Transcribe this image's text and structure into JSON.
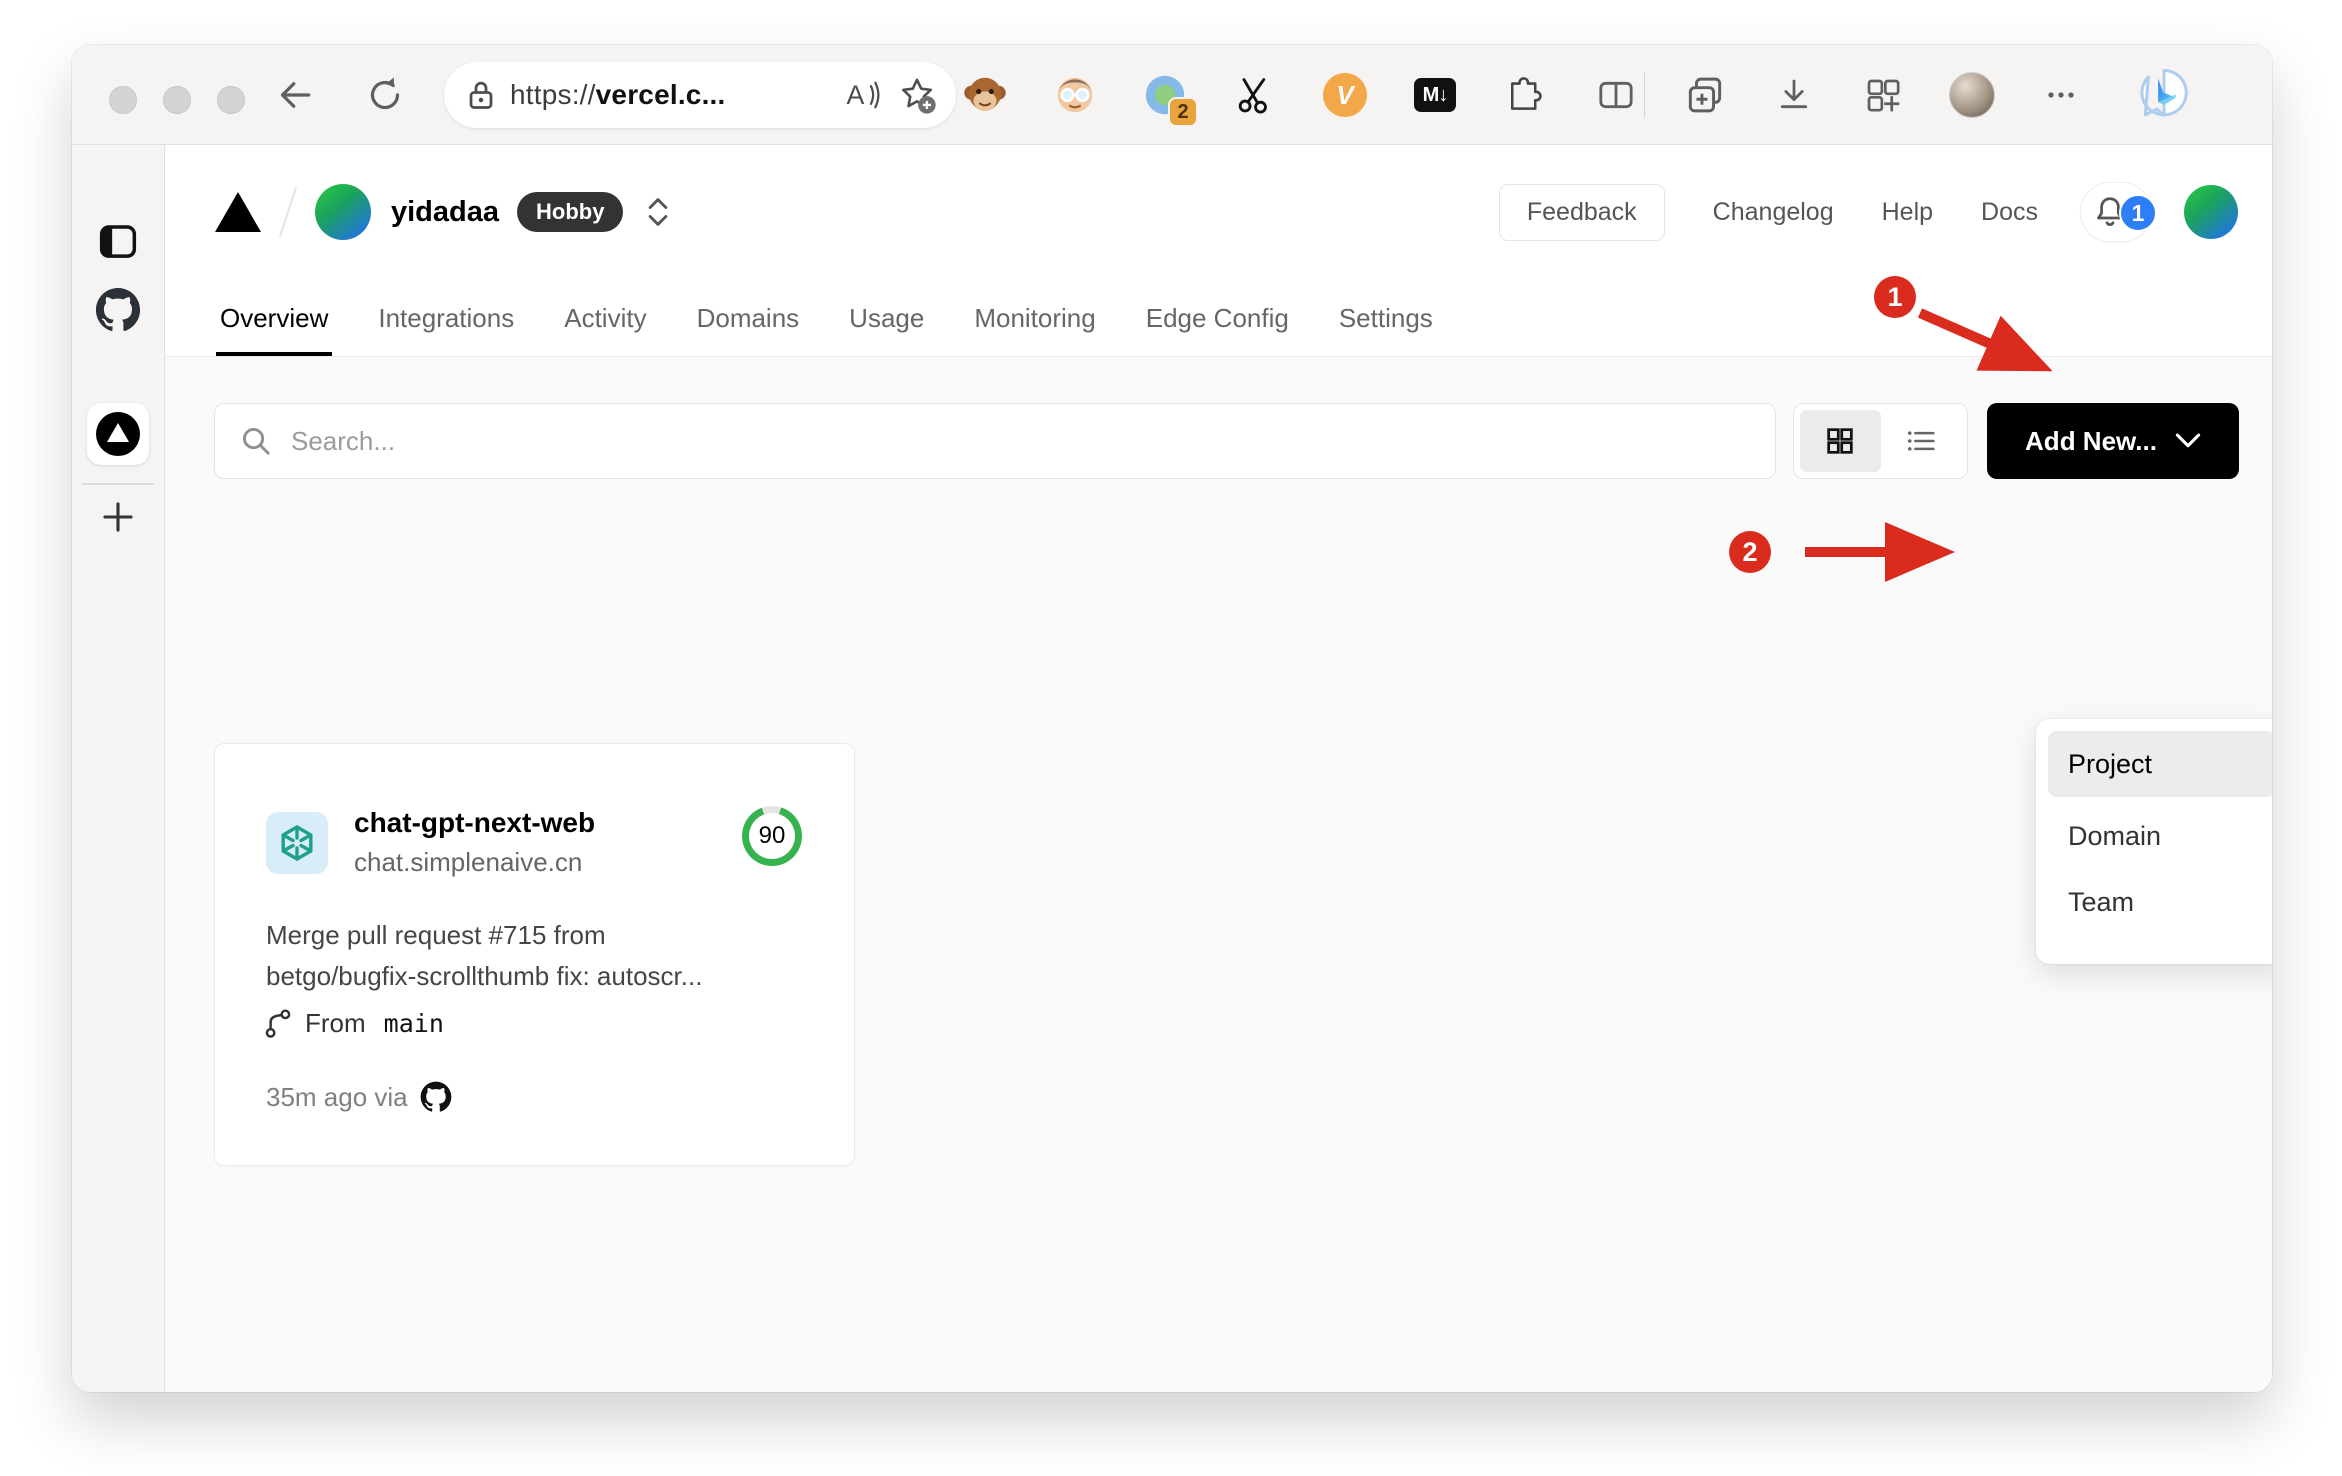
{
  "browser": {
    "url_prefix": "https://",
    "url_host": "vercel.c...",
    "reader_label": "A",
    "extensions": {
      "tab_count_badge": "2",
      "v_label": "V",
      "md_label": "M↓"
    }
  },
  "header": {
    "team_name": "yidadaa",
    "plan": "Hobby",
    "feedback": "Feedback",
    "nav": [
      "Changelog",
      "Help",
      "Docs"
    ],
    "notification_count": "1"
  },
  "tabs": {
    "items": [
      "Overview",
      "Integrations",
      "Activity",
      "Domains",
      "Usage",
      "Monitoring",
      "Edge Config",
      "Settings"
    ],
    "active": "Overview"
  },
  "controls": {
    "search_placeholder": "Search...",
    "add_new": "Add New..."
  },
  "dropdown": {
    "items": [
      "Project",
      "Domain",
      "Team"
    ],
    "highlighted": "Project"
  },
  "project_card": {
    "name": "chat-gpt-next-web",
    "domain": "chat.simplenaive.cn",
    "score": "90",
    "commit_line1": "Merge pull request #715 from",
    "commit_line2": "betgo/bugfix-scrollthumb fix: autoscr...",
    "branch_label": "From",
    "branch_name": "main",
    "deployed": "35m ago via"
  },
  "annotations": {
    "step_1": "1",
    "step_2": "2"
  },
  "colors": {
    "accent_button": "#000000",
    "annotation_red": "#d92b1e",
    "score_ring_green": "#36b24f",
    "notification_blue": "#2d7ef7",
    "hobby_badge_bg": "#333333",
    "content_bg": "#fafafa"
  }
}
